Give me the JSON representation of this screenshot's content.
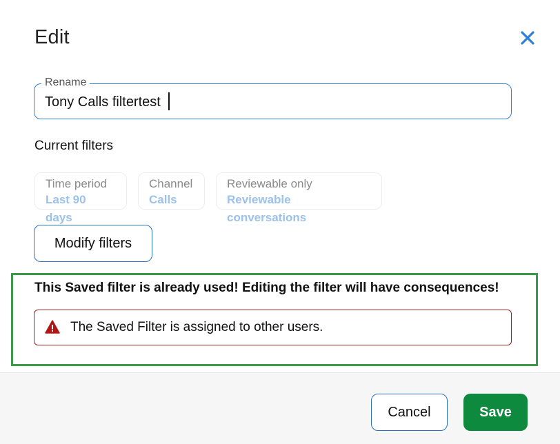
{
  "dialog": {
    "title": "Edit",
    "close_icon": "close-icon"
  },
  "rename": {
    "label": "Rename",
    "value": "Tony Calls filtertest"
  },
  "current_filters": {
    "title": "Current filters",
    "chips": [
      {
        "label": "Time period",
        "value": "Last 90 days"
      },
      {
        "label": "Channel",
        "value": "Calls"
      },
      {
        "label": "Reviewable only",
        "value": "Reviewable conversations"
      }
    ]
  },
  "modify_filters_label": "Modify filters",
  "warning": {
    "heading": "This Saved filter is already used! Editing the filter will have consequences!",
    "alert_icon": "warning-triangle-icon",
    "alert_text": "The Saved Filter is assigned to other users."
  },
  "footer": {
    "cancel_label": "Cancel",
    "save_label": "Save"
  },
  "colors": {
    "accent_blue": "#2f7fd8",
    "save_green": "#0e8a3e",
    "alert_red": "#9b1c1c",
    "highlight_green": "#3a9a46"
  }
}
